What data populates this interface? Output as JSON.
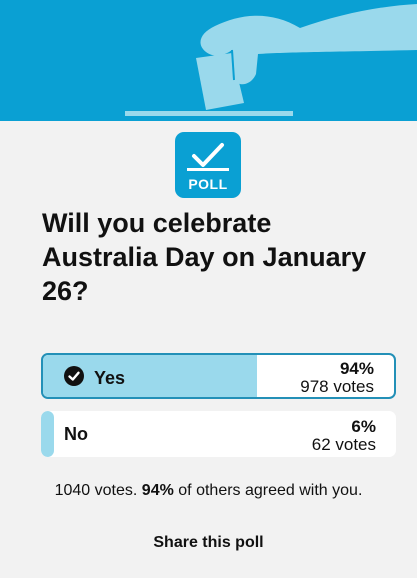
{
  "poll_badge": {
    "label": "POLL",
    "icon": "checkmark-icon"
  },
  "question": "Will you celebrate Australia Day on January 26?",
  "options": [
    {
      "label": "Yes",
      "percent_text": "94%",
      "votes_text": "978 votes",
      "percent": 94,
      "selected": true
    },
    {
      "label": "No",
      "percent_text": "6%",
      "votes_text": "62 votes",
      "percent": 6,
      "selected": false
    }
  ],
  "summary": {
    "total_text": "1040 votes.",
    "agree_percent": "94%",
    "agree_text": "of others agreed with you."
  },
  "share_label": "Share this poll",
  "colors": {
    "banner": "#0aa0d3",
    "bar_fill": "#9ad9ec",
    "selected_border": "#2390b7",
    "background": "#f2f2f2"
  }
}
